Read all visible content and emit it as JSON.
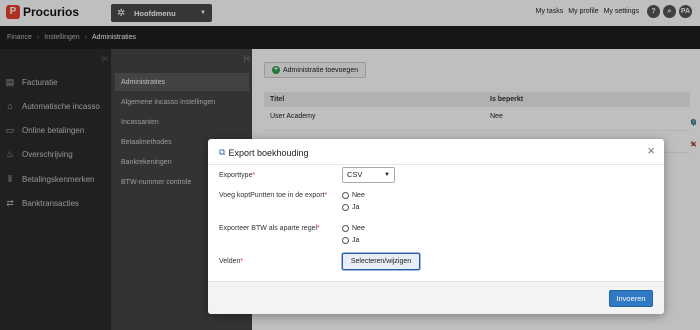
{
  "app": {
    "logo_letter": "P",
    "logo_text": "Procurios"
  },
  "main_menu": {
    "label": "Hoofdmenu",
    "icon": "cog-icon"
  },
  "top_links": [
    "My tasks",
    "My profile",
    "My settings"
  ],
  "top_buttons": {
    "help": "?",
    "search": "⌕",
    "user_initials": "PA"
  },
  "breadcrumb": {
    "items": [
      "Finance",
      "Instellingen"
    ],
    "current": "Administraties"
  },
  "sidebar": {
    "items": [
      {
        "label": "Facturatie",
        "icon": "invoice-icon"
      },
      {
        "label": "Automatische incasso",
        "icon": "bank-icon"
      },
      {
        "label": "Online betalingen",
        "icon": "card-icon"
      },
      {
        "label": "Overschrijving",
        "icon": "transfer-icon"
      },
      {
        "label": "Betalingskenmerken",
        "icon": "barcode-icon"
      },
      {
        "label": "Banktransacties",
        "icon": "exchange-icon"
      }
    ]
  },
  "subnav": {
    "items": [
      {
        "label": "Administraties",
        "active": true
      },
      {
        "label": "Algemene incasso instellingen",
        "active": false
      },
      {
        "label": "Incassanten",
        "active": false
      },
      {
        "label": "Betaalmethodes",
        "active": false
      },
      {
        "label": "Bankrekeningen",
        "active": false
      },
      {
        "label": "BTW-nummer controle",
        "active": false
      }
    ]
  },
  "content": {
    "add_button": "Administratie toevoegen",
    "table": {
      "columns": [
        "Titel",
        "Is beperkt"
      ],
      "rows": [
        {
          "titel": "User Academy",
          "beperkt": "Nee"
        }
      ]
    }
  },
  "modal": {
    "title": "Export boekhouding",
    "close": "×",
    "fields": {
      "exporttype_label": "Exporttype",
      "exporttype_value": "CSV",
      "koptekst_label": "Voeg koptPuntten toe in de export",
      "btw_label": "Exporteer BTW als aparte regel",
      "velden_label": "Velden",
      "required_mark": "*"
    },
    "options": {
      "nee": "Nee",
      "ja": "Ja"
    },
    "select_button": "Selecteren/wijzigen",
    "submit_button": "Invoeren"
  },
  "colors": {
    "brand": "#e8412b",
    "primary": "#3079c5",
    "add_green": "#27a24a"
  }
}
